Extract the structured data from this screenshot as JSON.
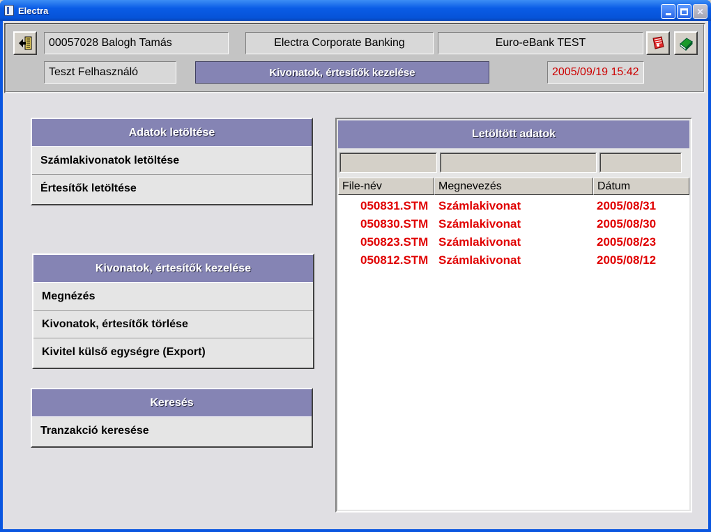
{
  "window": {
    "title": "Electra"
  },
  "header": {
    "user": "00057028 Balogh Tamás",
    "product": "Electra Corporate Banking",
    "bank": "Euro-eBank TEST",
    "role": "Teszt Felhasználó",
    "section_title": "Kivonatok, értesítők kezelése",
    "datetime": "2005/09/19 15:42",
    "datetime_color": "#cc0000"
  },
  "panels": {
    "download": {
      "title": "Adatok letöltése",
      "items": [
        "Számlakivonatok letöltése",
        "Értesítők letöltése"
      ]
    },
    "manage": {
      "title": "Kivonatok, értesítők kezelése",
      "items": [
        "Megnézés",
        "Kivonatok, értesítők törlése",
        "Kivitel külső egységre (Export)"
      ]
    },
    "search": {
      "title": "Keresés",
      "items": [
        "Tranzakció keresése"
      ]
    }
  },
  "downloaded": {
    "title": "Letöltött adatok",
    "columns": [
      "File-név",
      "Megnevezés",
      "Dátum"
    ],
    "rows": [
      {
        "file": "050831.STM",
        "name": "Számlakivonat",
        "date": "2005/08/31"
      },
      {
        "file": "050830.STM",
        "name": "Számlakivonat",
        "date": "2005/08/30"
      },
      {
        "file": "050823.STM",
        "name": "Számlakivonat",
        "date": "2005/08/23"
      },
      {
        "file": "050812.STM",
        "name": "Számlakivonat",
        "date": "2005/08/12"
      }
    ],
    "row_color": "#e00000"
  },
  "icons": [
    "exit-icon",
    "phone-book-icon",
    "help-book-icon"
  ],
  "colors": {
    "panel_header": "#8584b4",
    "titlebar": "#0a5ce6"
  }
}
